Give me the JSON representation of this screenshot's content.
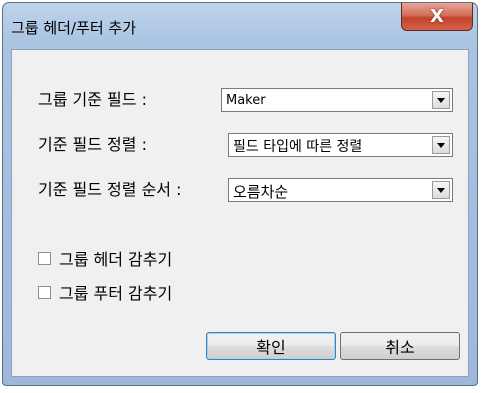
{
  "window": {
    "title": "그룹 헤더/푸터 추가",
    "close_symbol": "X"
  },
  "form": {
    "group_field_label": "그룹 기준 필드 :",
    "group_field_value": "Maker",
    "sort_label": "기준 필드 정렬 :",
    "sort_value": "필드 타입에 따른 정렬",
    "order_label": "기준 필드 정렬 순서 :",
    "order_value": "오름차순"
  },
  "options": {
    "hide_header_label": "그룹 헤더 감추기",
    "hide_header_checked": false,
    "hide_footer_label": "그룹 푸터 감추기",
    "hide_footer_checked": false
  },
  "buttons": {
    "ok_label": "확인",
    "cancel_label": "취소"
  },
  "icons": {
    "close": "close-icon",
    "dropdown": "chevron-down-icon"
  }
}
